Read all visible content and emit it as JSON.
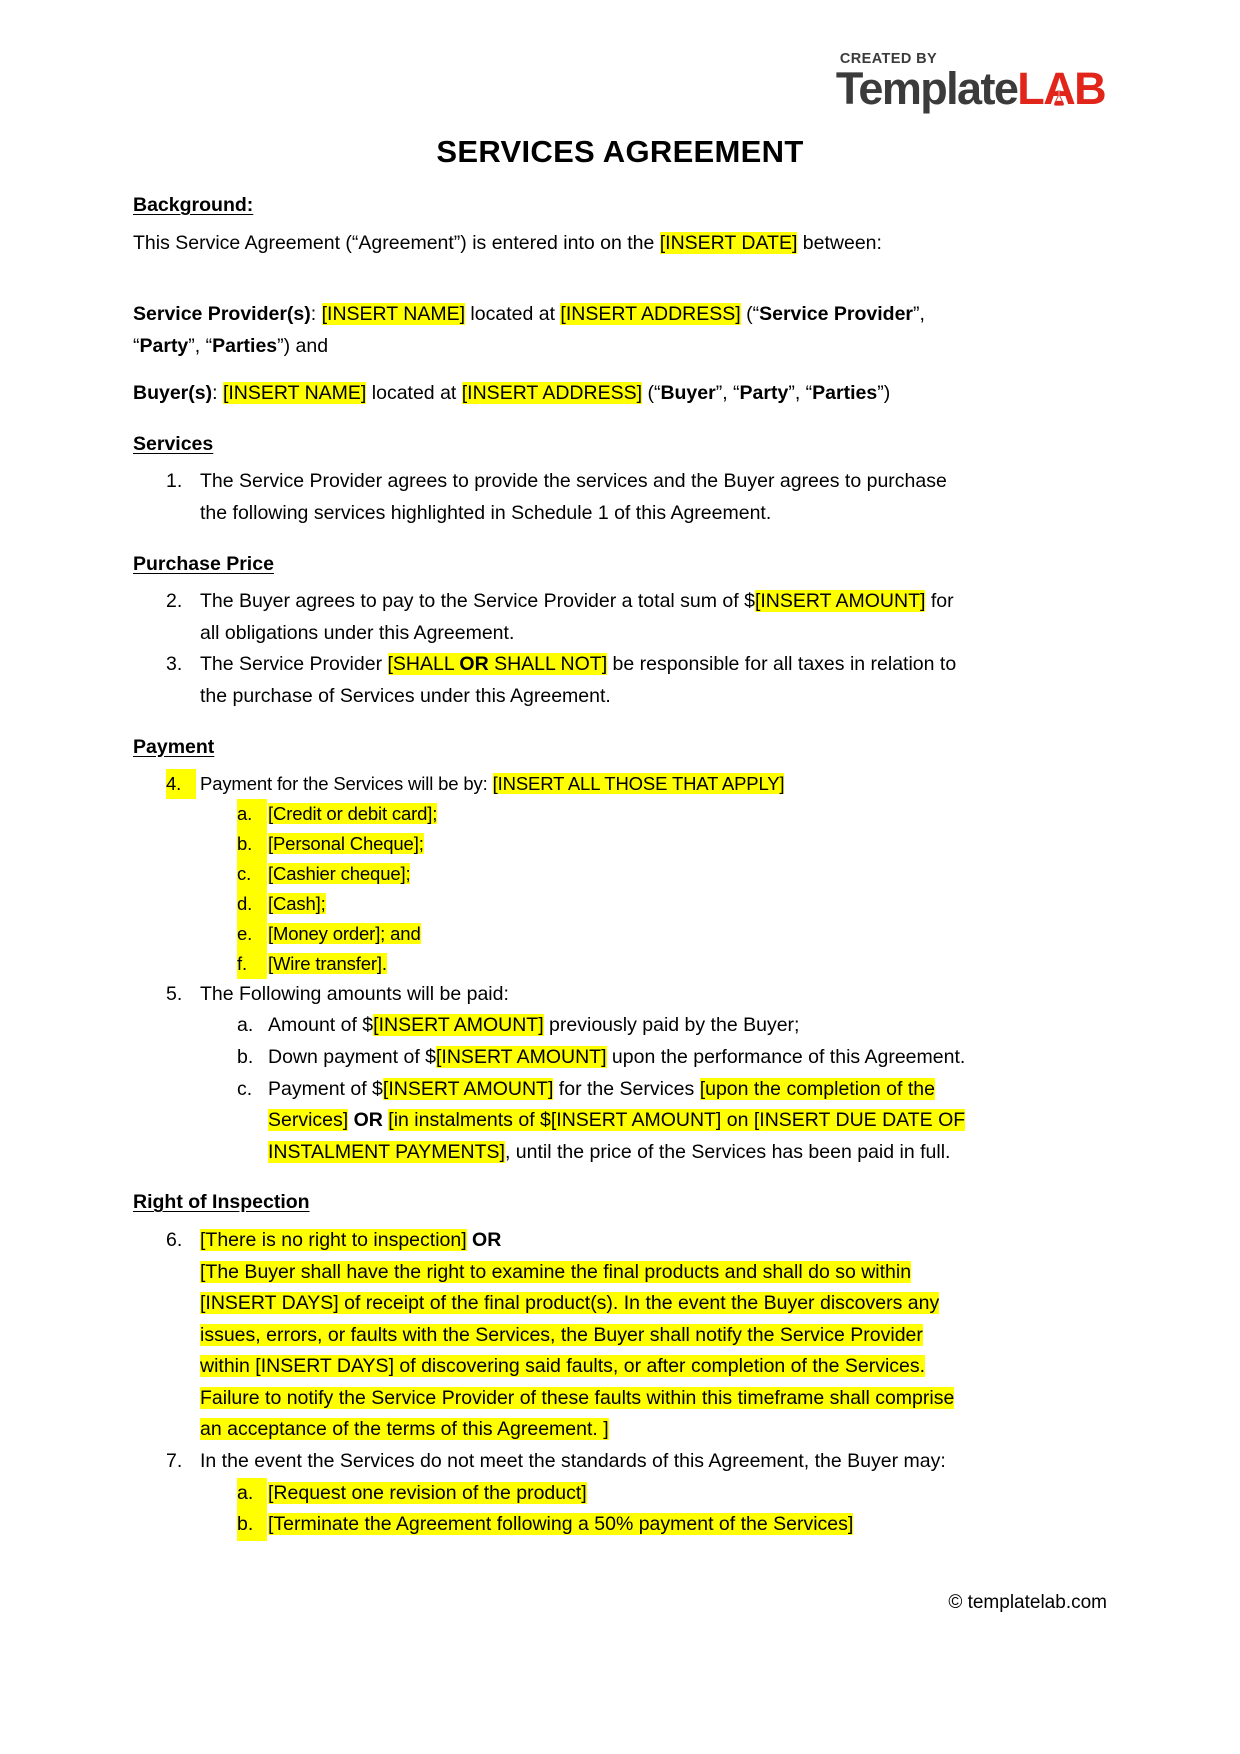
{
  "logo": {
    "created_by": "CREATED BY",
    "name_dark": "Template",
    "name_red_l": "L",
    "name_red_a": "A",
    "name_red_b": "B",
    "color_dark": "#3B3B3B",
    "color_red": "#E1251B"
  },
  "title": "SERVICES AGREEMENT",
  "highlight_color": "#FFFF00",
  "sections": {
    "background": {
      "heading": "Background:",
      "intro_pre": "This Service Agreement (“Agreement”) is entered into on the ",
      "intro_date": "[INSERT DATE]",
      "intro_post": " between:",
      "provider_label": "Service Provider(s)",
      "provider_colon": ": ",
      "provider_name": "[INSERT NAME]",
      "provider_mid": " located at ",
      "provider_address": "[INSERT ADDRESS]",
      "provider_tail_open": " (“",
      "provider_tail_b1": "Service Provider",
      "provider_tail_sep1": "”, “",
      "provider_tail_b2": "Party",
      "provider_tail_sep2": "”, “",
      "provider_tail_b3": "Parties",
      "provider_tail_close": "”) and",
      "buyer_label": "Buyer(s)",
      "buyer_colon": ": ",
      "buyer_name": "[INSERT NAME]",
      "buyer_mid": " located at ",
      "buyer_address": "[INSERT ADDRESS]",
      "buyer_tail_open": " (“",
      "buyer_tail_b1": "Buyer",
      "buyer_tail_sep1": "”, “",
      "buyer_tail_b2": "Party",
      "buyer_tail_sep2": "”, “",
      "buyer_tail_b3": "Parties",
      "buyer_tail_close": "”)"
    },
    "services": {
      "heading": "Services",
      "item1_marker": "1.",
      "item1_text": "The Service Provider agrees to provide the services and the Buyer agrees to purchase the following services highlighted in Schedule 1 of this Agreement."
    },
    "purchase_price": {
      "heading": "Purchase Price",
      "item2_marker": "2.",
      "item2_pre": "The Buyer agrees to pay to the Service Provider a total sum of $",
      "item2_hl": "[INSERT AMOUNT]",
      "item2_post": " for all obligations under this Agreement.",
      "item3_marker": "3.",
      "item3_pre": "The Service Provider ",
      "item3_hl_a": "[SHALL ",
      "item3_hl_b": "OR",
      "item3_hl_c": " SHALL NOT]",
      "item3_post": " be responsible for all taxes in relation to the purchase of Services under this Agreement."
    },
    "payment": {
      "heading": "Payment",
      "item4_marker": "4.",
      "item4_pre": "Payment for the Services will be by: ",
      "item4_hl": "[INSERT ALL THOSE THAT APPLY]",
      "item4_sub": [
        {
          "marker": "a.",
          "text": "[Credit or debit card];"
        },
        {
          "marker": "b.",
          "text": "[Personal Cheque];"
        },
        {
          "marker": "c.",
          "text": "[Cashier cheque];"
        },
        {
          "marker": "d.",
          "text": "[Cash];"
        },
        {
          "marker": "e.",
          "text": "[Money order]; and"
        },
        {
          "marker": "f.",
          "text": "[Wire transfer]."
        }
      ],
      "item5_marker": "5.",
      "item5_text": "The Following amounts will be paid:",
      "item5a_marker": "a.",
      "item5a_pre": "Amount of $",
      "item5a_hl": "[INSERT AMOUNT]",
      "item5a_post": " previously paid by the Buyer;",
      "item5b_marker": "b.",
      "item5b_pre": "Down payment of $",
      "item5b_hl": "[INSERT AMOUNT]",
      "item5b_post": " upon the performance of this Agreement.",
      "item5c_marker": "c.",
      "item5c_p1": "Payment of $",
      "item5c_hl1": "[INSERT AMOUNT]",
      "item5c_p2": " for the Services ",
      "item5c_hl2": "[upon the completion of the Services]",
      "item5c_p3": " ",
      "item5c_or": "OR",
      "item5c_p4": " ",
      "item5c_hl3": "[in instalments of $[INSERT AMOUNT] on [INSERT DUE DATE OF INSTALMENT PAYMENTS]",
      "item5c_p5": ", until the price of the Services has been paid in full."
    },
    "right_of_inspection": {
      "heading": "Right of Inspection",
      "item6_marker": "6.",
      "item6_hl1": "[There is no right to inspection]",
      "item6_or": " OR",
      "item6_hl2": "[The Buyer shall have the right to examine the final products and shall do so within [INSERT DAYS] of receipt of the final product(s). In the event the Buyer discovers any issues, errors, or faults with the Services, the Buyer shall notify the Service Provider within [INSERT DAYS] of discovering said faults, or after completion of the Services. Failure to notify the Service Provider of these faults within this timeframe shall comprise an acceptance of the terms of this Agreement. ]",
      "item7_marker": "7.",
      "item7_text": "In the event the Services do not meet the standards of this Agreement, the Buyer may:",
      "item7_sub": [
        {
          "marker": "a.",
          "text": "[Request one revision of the product]"
        },
        {
          "marker": "b.",
          "text": "[Terminate the Agreement following a 50% payment of the Services]"
        }
      ]
    }
  },
  "footer": "© templatelab.com"
}
